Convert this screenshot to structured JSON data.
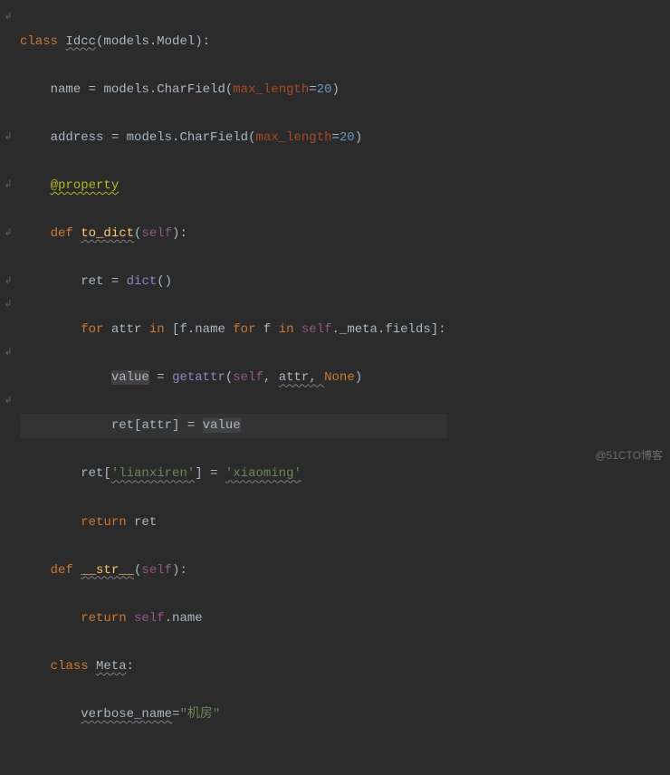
{
  "gutter": [
    "↲",
    "",
    "",
    "",
    "",
    "↲",
    "",
    "↲",
    "",
    "↲",
    "",
    "↲",
    "↲",
    "",
    "↲",
    "",
    "↲"
  ],
  "code": {
    "l1": {
      "kw": "class ",
      "cls": "Idcc",
      "par": "(models.Model):"
    },
    "l2": {
      "indent": "    ",
      "name": "name",
      "eq": " = ",
      "mod": "models.",
      "fn": "CharField",
      "open": "(",
      "p": "max_length",
      "eq2": "=",
      "val": "20",
      "close": ")"
    },
    "l3": {
      "indent": "    ",
      "name": "address",
      "eq": " = ",
      "mod": "models.",
      "fn": "CharField",
      "open": "(",
      "p": "max_length",
      "eq2": "=",
      "val": "20",
      "close": ")"
    },
    "l4": {
      "indent": "    ",
      "dec": "@property"
    },
    "l5": {
      "indent": "    ",
      "kw": "def ",
      "fn": "to_dict",
      "open": "(",
      "self": "self",
      "close": "):"
    },
    "l6": {
      "indent": "        ",
      "name": "ret",
      "eq": " = ",
      "fn": "dict",
      "paren": "()"
    },
    "l7": {
      "indent": "        ",
      "kw": "for ",
      "v": "attr",
      "in": " in ",
      "open": "[",
      "f": "f",
      "dot": ".name ",
      "kw2": "for ",
      "f2": "f",
      "in2": " in ",
      "self": "self",
      "meta": "._meta.fields]:"
    },
    "l8": {
      "indent": "            ",
      "name": "value",
      "eq": " = ",
      "fn": "getattr",
      "open": "(",
      "self": "self",
      "comma": ", ",
      "attr": "attr",
      "c2": ", ",
      "none": "None",
      "close": ")"
    },
    "l9": {
      "indent": "            ",
      "ret": "ret[",
      "attr": "attr",
      "close": "] = ",
      "val": "value"
    },
    "l10": {
      "indent": "        ",
      "ret": "ret[",
      "str": "'lianxiren'",
      "eq": "] = ",
      "str2": "'xiaoming'"
    },
    "l11": {
      "indent": "        ",
      "kw": "return ",
      "v": "ret"
    },
    "l12": {
      "indent": "    ",
      "kw": "def ",
      "fn": "__str__",
      "open": "(",
      "self": "self",
      "close": "):"
    },
    "l13": {
      "indent": "        ",
      "kw": "return ",
      "self": "self",
      "dot": ".name"
    },
    "l14": {
      "indent": "    ",
      "kw": "class ",
      "cls": "Meta",
      ":": ":"
    },
    "l15": {
      "indent": "        ",
      "name": "verbose_name",
      "eq": "=",
      "str": "\"机房\""
    }
  },
  "watermark": "@51CTO博客"
}
